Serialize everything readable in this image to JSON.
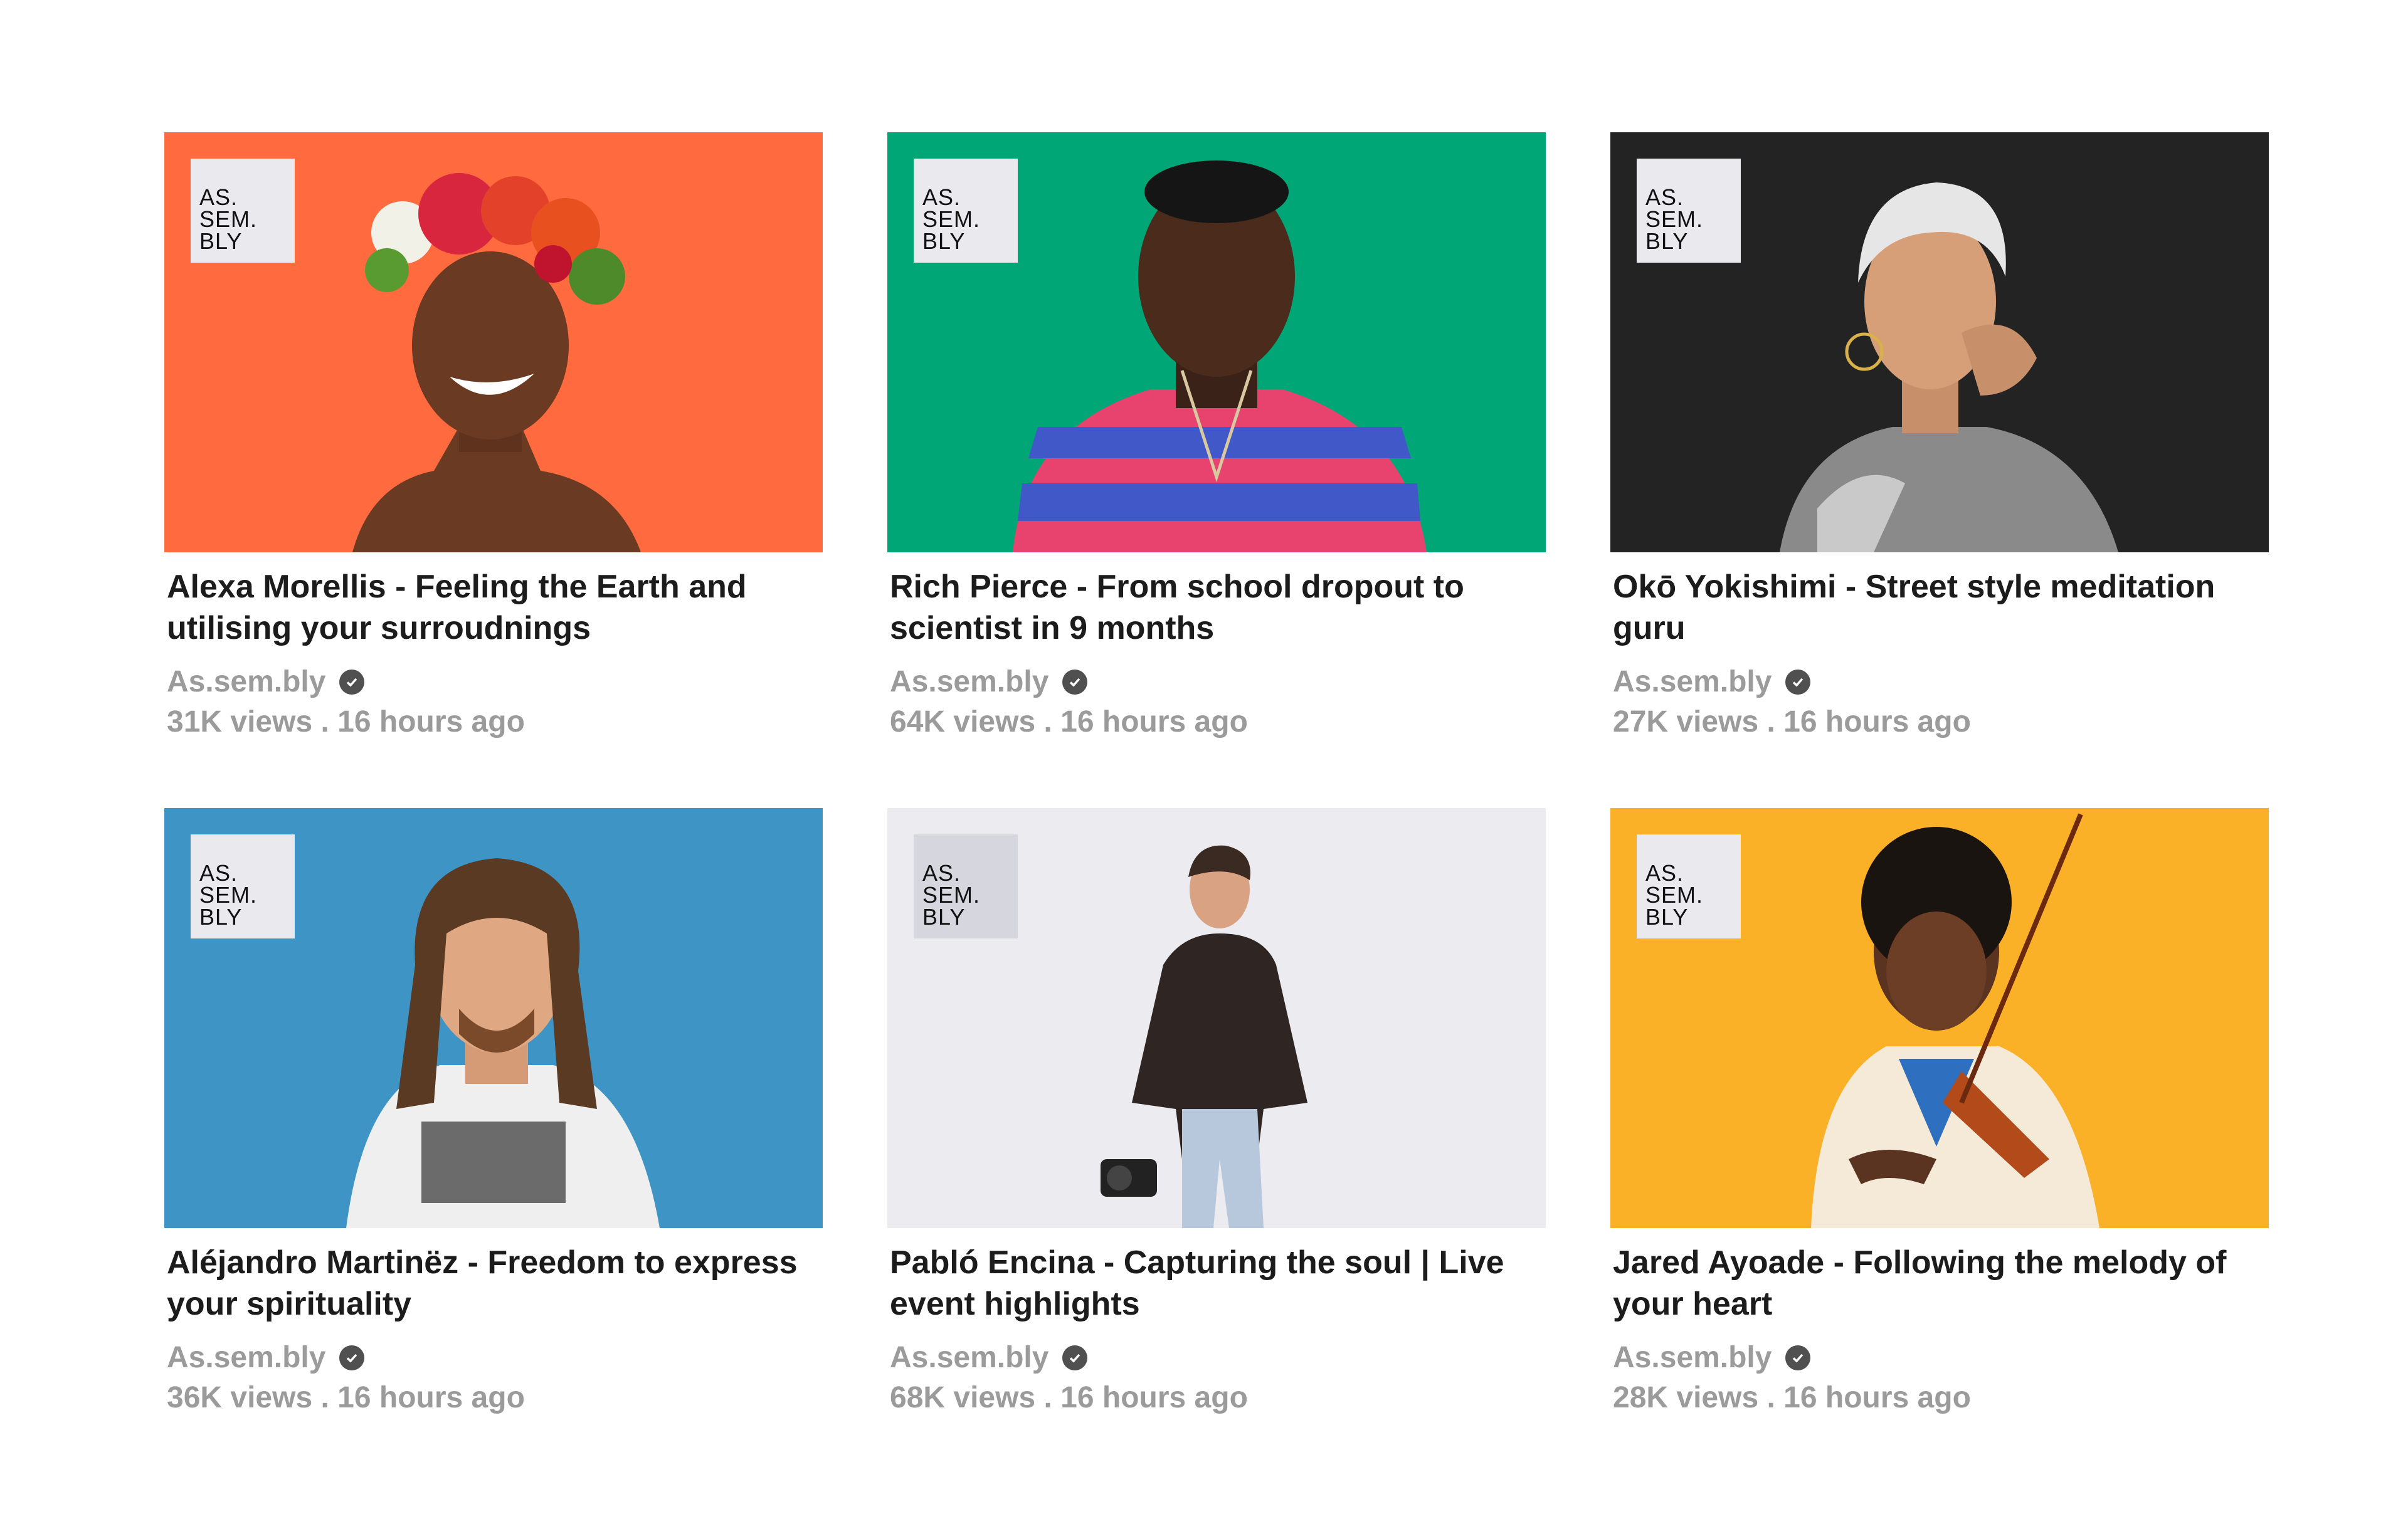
{
  "logo": {
    "line1": "AS.",
    "line2": "SEM.",
    "line3": "BLY"
  },
  "videos": [
    {
      "title": "Alexa Morellis - Feeling the Earth and utilising your surroudnings",
      "channel": "As.sem.bly",
      "meta": "31K views . 16 hours ago",
      "bg": "#ff6a3e"
    },
    {
      "title": "Rich Pierce - From school dropout to scientist in 9 months",
      "channel": "As.sem.bly",
      "meta": "64K views . 16 hours ago",
      "bg": "#00a676"
    },
    {
      "title": "Okō Yokishimi - Street style meditation guru",
      "channel": "As.sem.bly",
      "meta": "27K views . 16 hours ago",
      "bg": "#232323"
    },
    {
      "title": "Aléjandro Martinëz - Freedom to express your spirituality",
      "channel": "As.sem.bly",
      "meta": "36K views . 16 hours ago",
      "bg": "#3e94c4"
    },
    {
      "title": "Pabló Encina - Capturing the soul | Live event highlights",
      "channel": "As.sem.bly",
      "meta": "68K views . 16 hours ago",
      "bg": "#ebebf0"
    },
    {
      "title": "Jared Ayoade - Following the melody of your heart",
      "channel": "As.sem.bly",
      "meta": "28K views . 16 hours ago",
      "bg": "#fbb127"
    }
  ]
}
